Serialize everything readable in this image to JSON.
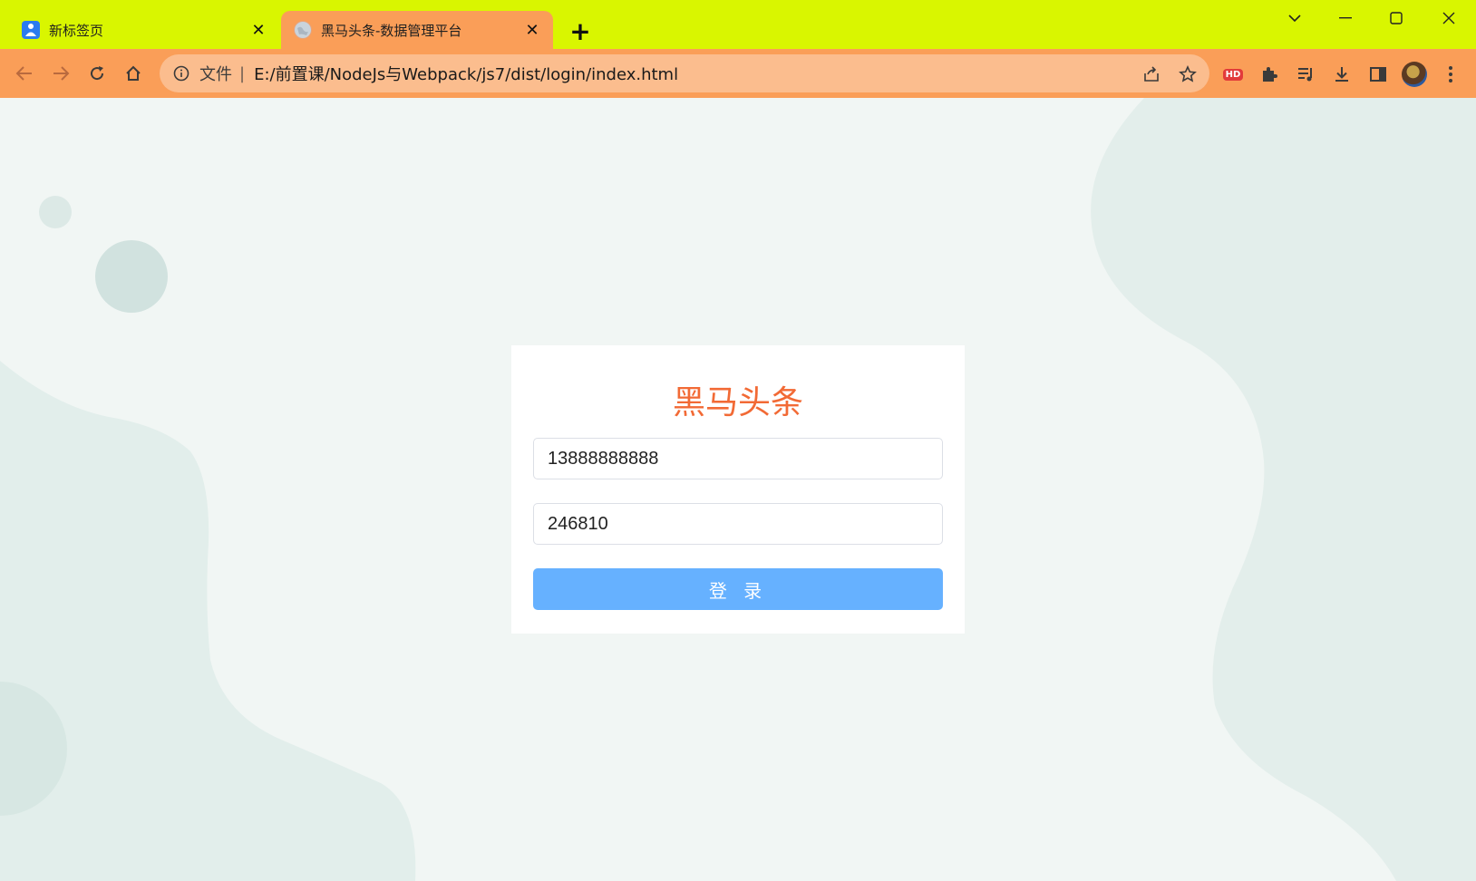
{
  "browser": {
    "tabs": [
      {
        "title": "新标签页",
        "favicon": "new-tab-favicon-icon",
        "active": false
      },
      {
        "title": "黑马头条-数据管理平台",
        "favicon": "globe-icon",
        "active": true
      }
    ],
    "close_glyph": "✕",
    "new_tab_glyph": "+",
    "omnibox": {
      "scheme_label": "文件",
      "separator": "|",
      "url": "E:/前置课/NodeJs与Webpack/js7/dist/login/index.html"
    },
    "extension_badge": "HD",
    "colors": {
      "tabstrip": "#d9f600",
      "toolbar": "#fa9e58",
      "omnibox": "#fbbd8e"
    }
  },
  "login": {
    "title": "黑马头条",
    "phone_value": "13888888888",
    "code_value": "246810",
    "submit_label": "登 录",
    "colors": {
      "title": "#f26a35",
      "button": "#66b1ff",
      "background": "#f1f6f4"
    }
  }
}
